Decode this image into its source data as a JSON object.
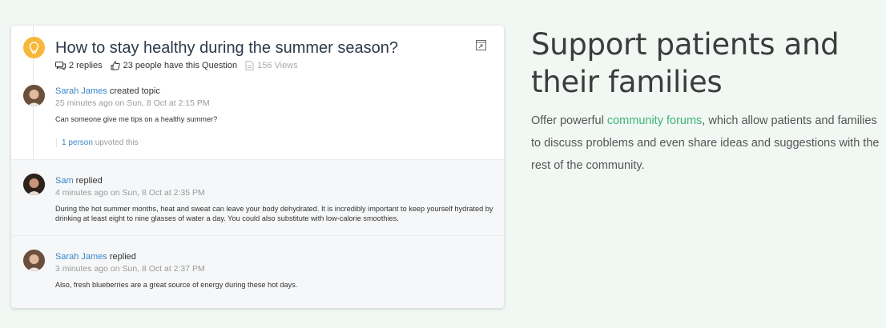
{
  "question": {
    "title": "How to stay healthy during the summer season?",
    "replies": "2 replies",
    "have_question": "23 people have this Question",
    "views": "156 Views"
  },
  "posts": [
    {
      "author": "Sarah James",
      "action": " created topic",
      "time": "25 minutes ago on Sun, 8 Oct at 2:15 PM",
      "body": "Can someone give me tips on a healthy summer?",
      "upvote_count": "1 person",
      "upvote_text": " upvoted this"
    },
    {
      "author": "Sam",
      "action": " replied",
      "time": "4 minutes ago on Sun, 8 Oct at 2:35 PM",
      "body": "During the hot summer months, heat and sweat can leave your body dehydrated. It is incredibly important to keep yourself hydrated by drinking at least eight to nine glasses of water a day. You could also substitute with low-calorie smoothies."
    },
    {
      "author": "Sarah James",
      "action": " replied",
      "time": "3 minutes ago on Sun, 8 Oct at 2:37 PM",
      "body": "Also, fresh blueberries are a great source of energy during these hot days."
    }
  ],
  "promo": {
    "heading": "Support patients and their families",
    "desc_before": "Offer powerful ",
    "desc_link": "community forums",
    "desc_after": ", which allow patients and families to discuss problems and even share ideas and suggestions with the rest of the community."
  },
  "colors": {
    "background": "#f1f8f3",
    "link": "#3a86c8",
    "highlight": "#3fb27a",
    "question_icon": "#f7b73a"
  },
  "icons": [
    "lightbulb-icon",
    "comments-icon",
    "thumbs-up-icon",
    "views-icon",
    "expand-icon"
  ]
}
